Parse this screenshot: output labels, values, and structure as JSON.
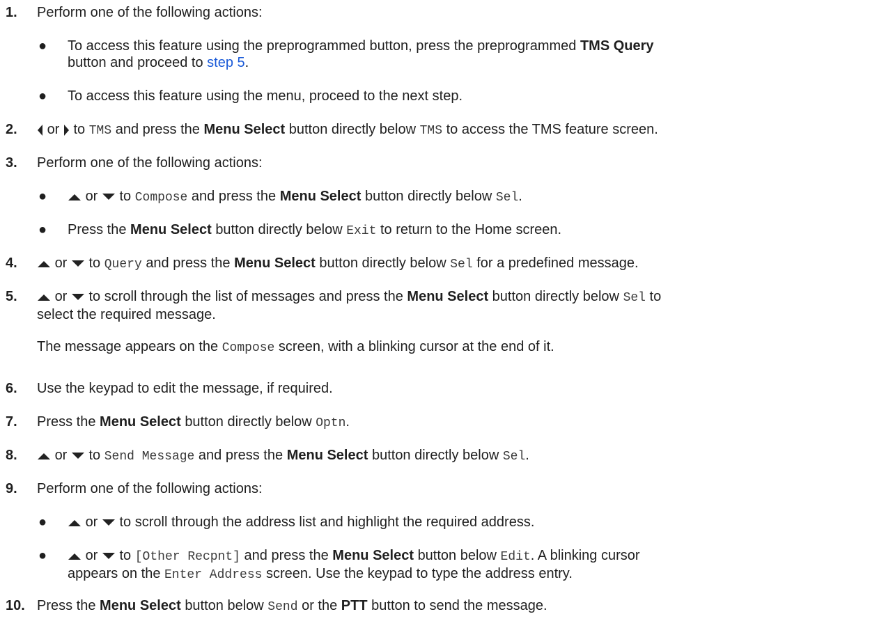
{
  "steps": [
    {
      "num": "1.",
      "t1": "Perform one of the following actions:"
    },
    {
      "num": "2.",
      "t1": "or",
      "t2": "to",
      "code1": "TMS",
      "t3": "and press the",
      "b1": "Menu Select",
      "t4": "button directly below",
      "code2": "TMS",
      "t5": "to access the TMS feature screen."
    },
    {
      "num": "3.",
      "t1": "Perform one of the following actions:"
    },
    {
      "num": "4.",
      "t1": "or",
      "t2": "to",
      "code1": "Query",
      "t3": "and press the",
      "b1": "Menu Select",
      "t4": "button directly below",
      "code2": "Sel",
      "t5": "for a predefined message."
    },
    {
      "num": "5.",
      "t1": "or",
      "t2": "to scroll through the list of messages and press the",
      "b1": "Menu Select",
      "t3": "button directly below",
      "code1": "Sel",
      "t4": "to",
      "t5": "select the required message."
    },
    {
      "num": "6.",
      "t1": "Use the keypad to edit the message, if required."
    },
    {
      "num": "7.",
      "t1": "Press the",
      "b1": "Menu Select",
      "t2": "button directly below",
      "code1": "Optn",
      "t3": "."
    },
    {
      "num": "8.",
      "t1": "or",
      "t2": "to",
      "code1": "Send Message",
      "t3": "and press the",
      "b1": "Menu Select",
      "t4": "button directly below",
      "code2": "Sel",
      "t5": "."
    },
    {
      "num": "9.",
      "t1": "Perform one of the following actions:"
    },
    {
      "num": "10.",
      "t1": "Press the",
      "b1": "Menu Select",
      "t2": "button below",
      "code1": "Send",
      "t3": "or the",
      "b2": "PTT",
      "t4": "button to send the message."
    }
  ],
  "s1": {
    "b1": {
      "t1": "To access this feature using the preprogrammed button, press the preprogrammed",
      "b1": "TMS Query",
      "t2": "button and proceed to",
      "link": "step 5",
      "t3": "."
    },
    "b2": {
      "t1": "To access this feature using the menu, proceed to the next step."
    }
  },
  "s3": {
    "b1": {
      "t1": "or",
      "t2": "to",
      "code1": "Compose",
      "t3": "and press the",
      "b1": "Menu Select",
      "t4": "button directly below",
      "code2": "Sel",
      "t5": "."
    },
    "b2": {
      "t1": "Press the",
      "b1": "Menu Select",
      "t2": "button directly below",
      "code1": "Exit",
      "t3": "to return to the Home screen."
    }
  },
  "s5note": {
    "t1": "The message appears on the",
    "code1": "Compose",
    "t2": "screen, with a blinking cursor at the end of it."
  },
  "s9": {
    "b1": {
      "t1": "or",
      "t2": "to scroll through the address list and highlight the required address."
    },
    "b2": {
      "t1": "or",
      "t2": "to",
      "code1": "[Other Recpnt]",
      "t3": "and press the",
      "b1": "Menu Select",
      "t4": "button below",
      "code2": "Edit",
      "t5": ". A blinking cursor",
      "t6": "appears on the",
      "code3": "Enter Address",
      "t7": "screen. Use the keypad to type the address entry."
    }
  },
  "bullet": "●",
  "icons": {
    "up": "up-arrow-icon",
    "down": "down-arrow-icon",
    "left": "left-arrow-icon",
    "right": "right-arrow-icon"
  }
}
